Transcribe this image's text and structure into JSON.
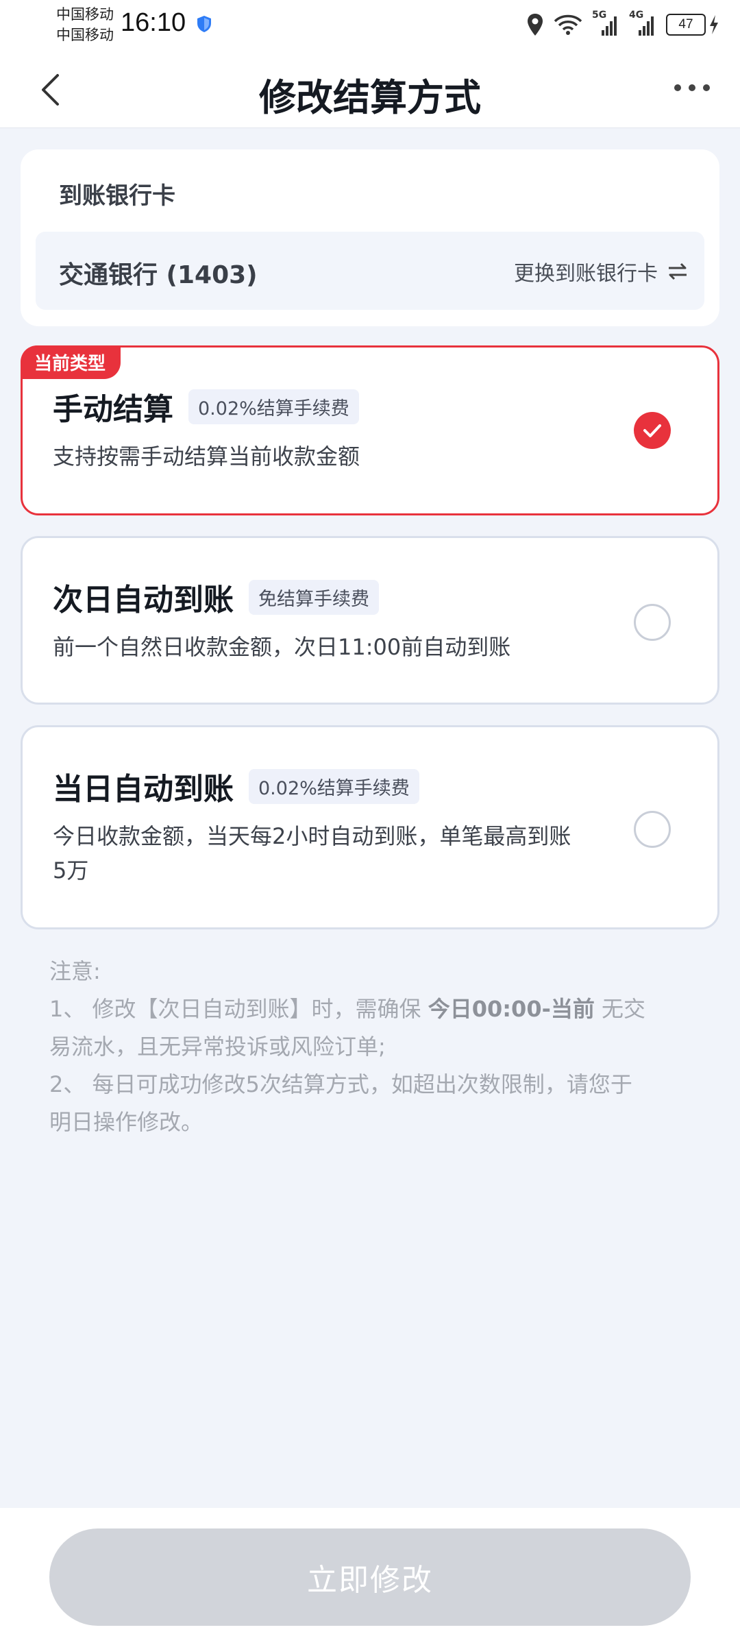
{
  "status_bar": {
    "carrier_1": "中国移动",
    "carrier_2": "中国移动",
    "time": "16:10",
    "signal_label_1": "5G",
    "signal_label_2": "4G",
    "battery": "47"
  },
  "header": {
    "title": "修改结算方式"
  },
  "bank": {
    "section_title": "到账银行卡",
    "bank_name": "交通银行 (1403)",
    "change_label": "更换到账银行卡"
  },
  "options": [
    {
      "tag": "当前类型",
      "title": "手动结算",
      "fee": "0.02%结算手续费",
      "desc": "支持按需手动结算当前收款金额",
      "selected": true
    },
    {
      "title": "次日自动到账",
      "fee": "免结算手续费",
      "desc": "前一个自然日收款金额，次日11:00前自动到账",
      "selected": false
    },
    {
      "title": "当日自动到账",
      "fee": "0.02%结算手续费",
      "desc_line1": "今日收款金额，当天每2小时自动到账，单笔最高到账",
      "desc_line2": "5万",
      "selected": false
    }
  ],
  "notes": {
    "heading": "注意:",
    "item1_prefix": "1、 修改【次日自动到账】时，需确保 ",
    "item1_bold": "今日00:00-当前",
    "item1_suffix": " 无交",
    "item1_line2": "易流水，且无异常投诉或风险订单;",
    "item2_line1": "2、 每日可成功修改5次结算方式，如超出次数限制，请您于",
    "item2_line2": "明日操作修改。"
  },
  "footer": {
    "submit_label": "立即修改"
  },
  "colors": {
    "accent": "#e8323c",
    "background": "#f1f4fa",
    "disabled_button": "#d1d4da"
  }
}
